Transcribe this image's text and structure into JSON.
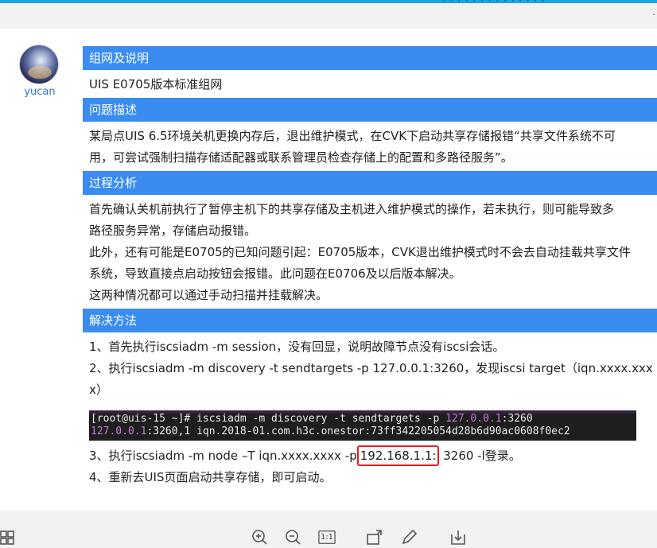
{
  "author": {
    "name": "yucan"
  },
  "sections": {
    "networking": {
      "header": "组网及说明",
      "text": "UIS E0705版本标准组网"
    },
    "problem": {
      "header": "问题描述",
      "line1": "某局点UIS 6.5环境关机更换内存后，退出维护模式，在CVK下启动共享存储报错“共享文件系统不可",
      "line2": "用，可尝试强制扫描存储适配器或联系管理员检查存储上的配置和多路径服务”。"
    },
    "analysis": {
      "header": "过程分析",
      "line1": "首先确认关机前执行了暂停主机下的共享存储及主机进入维护模式的操作，若未执行，则可能导致多",
      "line2": "路径服务异常，存储启动报错。",
      "line3": "此外，还有可能是E0705的已知问题引起：E0705版本，CVK退出维护模式时不会去自动挂载共享文件",
      "line4": "系统，导致直接点启动按钮会报错。此问题在E0706及以后版本解决。",
      "line5": "这两种情况都可以通过手动扫描并挂载解决。"
    },
    "solution": {
      "header": "解决方法",
      "step1": "1、首先执行iscsiadm -m session，没有回显，说明故障节点没有iscsi会话。",
      "step2a": "2、执行iscsiadm -m discovery -t sendtargets -p 127.0.0.1:3260，发现iscsi target（iqn.xxxx.xxx",
      "step2b": "x）",
      "terminal": {
        "prompt": "[root@uis-15 ~]# iscsiadm -m discovery -t sendtargets -p ",
        "ip1": "127.0.0.1",
        "port1": ":3260",
        "ip2": "127.0.0.1",
        "result": ":3260,1 iqn.2018-01.com.h3c.onestor:73ff342205054d28b6d90ac0608f0ec2"
      },
      "step3_prefix": "3、执行iscsiadm -m node –T iqn.xxxx.xxxx -p",
      "step3_ip": "192.168.1.1:",
      "step3_suffix": "3260 -l登录。",
      "step4": "4、重新去UIS页面启动共享存储，即可启动。"
    }
  },
  "toolbar": {
    "icons": [
      "grid-icon",
      "zoom-in-icon",
      "zoom-out-icon",
      "actual-size-icon",
      "rotate-icon",
      "edit-icon",
      "download-icon"
    ],
    "actual_size_label": "1:1"
  },
  "colors": {
    "section_header_bg": "#3a8cf0",
    "author_name": "#2b7bd0",
    "highlight_box": "#e0201d",
    "top_bar": "#1aa6e8"
  }
}
